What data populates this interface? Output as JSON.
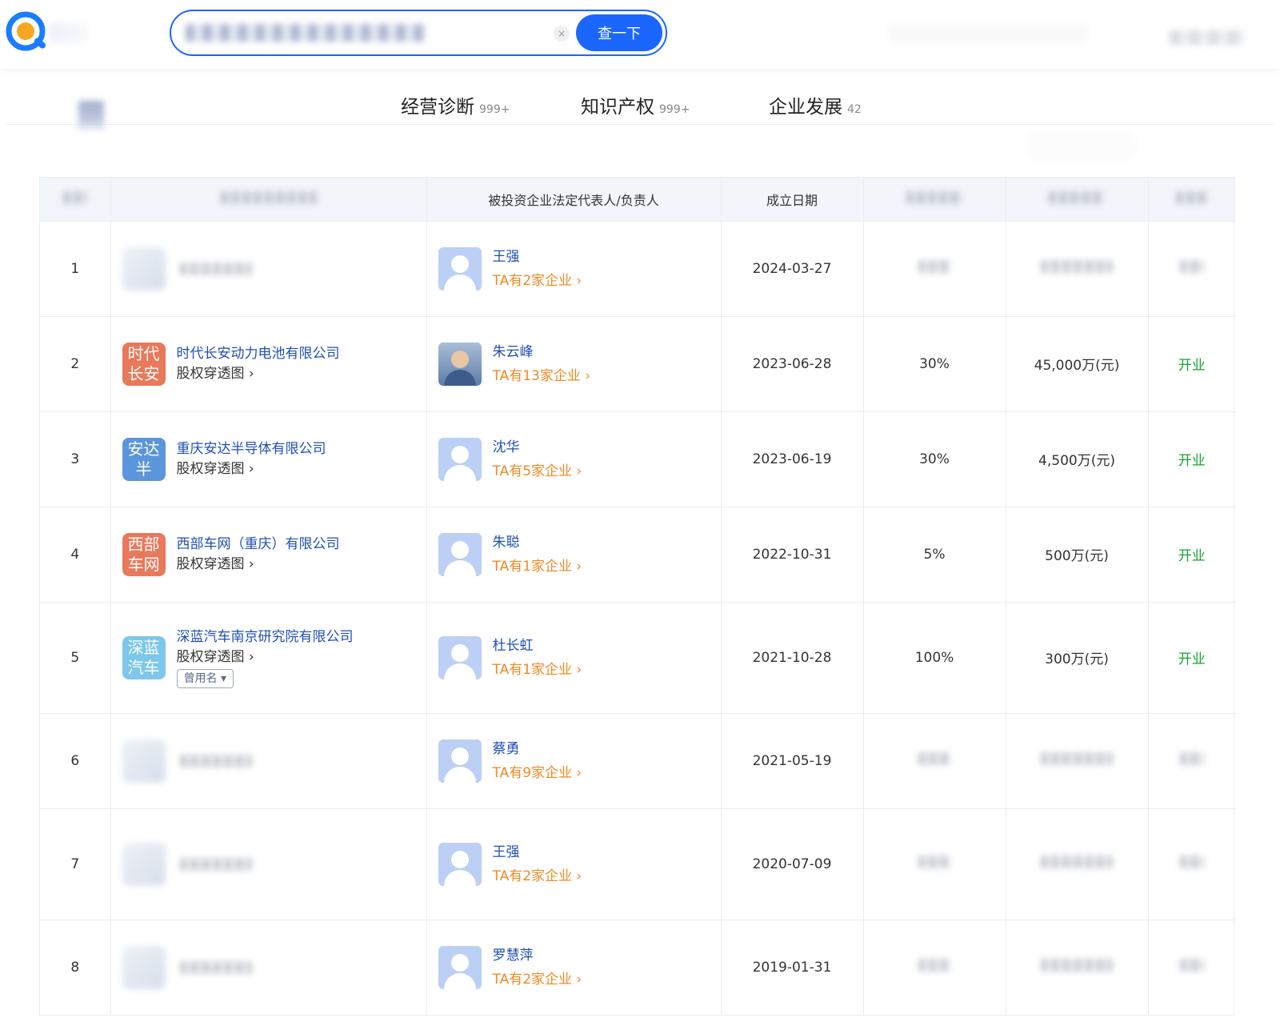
{
  "header": {
    "search_button_label": "查一下",
    "clear_icon": "close-icon",
    "clear_label": "×"
  },
  "tabs": [
    {
      "label": "经营诊断",
      "count": "999+"
    },
    {
      "label": "知识产权",
      "count": "999+"
    },
    {
      "label": "企业发展",
      "count": "42"
    }
  ],
  "table": {
    "columns": [
      "",
      "",
      "被投资企业法定代表人/负责人",
      "成立日期",
      "",
      "",
      ""
    ],
    "rows": [
      {
        "index": "1",
        "company": null,
        "person": "王强",
        "person_count": "TA有2家企业",
        "date": "2024-03-27",
        "ratio": null,
        "capital": null,
        "status": null,
        "avatar": "default"
      },
      {
        "index": "2",
        "company": {
          "logo_text": "时代\n长安",
          "logo_color": "#e8795a",
          "name": "时代长安动力电池有限公司",
          "equity": "股权穿透图"
        },
        "person": "朱云峰",
        "person_count": "TA有13家企业",
        "date": "2023-06-28",
        "ratio": "30%",
        "capital": "45,000万(元)",
        "status": "开业",
        "avatar": "photo"
      },
      {
        "index": "3",
        "company": {
          "logo_text": "安达\n半",
          "logo_color": "#5b95dc",
          "name": "重庆安达半导体有限公司",
          "equity": "股权穿透图"
        },
        "person": "沈华",
        "person_count": "TA有5家企业",
        "date": "2023-06-19",
        "ratio": "30%",
        "capital": "4,500万(元)",
        "status": "开业",
        "avatar": "default"
      },
      {
        "index": "4",
        "company": {
          "logo_text": "西部\n车网",
          "logo_color": "#e8795a",
          "name": "西部车网（重庆）有限公司",
          "equity": "股权穿透图"
        },
        "person": "朱聪",
        "person_count": "TA有1家企业",
        "date": "2022-10-31",
        "ratio": "5%",
        "capital": "500万(元)",
        "status": "开业",
        "avatar": "default"
      },
      {
        "index": "5",
        "company": {
          "logo_text": "深蓝\n汽车",
          "logo_color": "#7cc7ea",
          "name": "深蓝汽车南京研究院有限公司",
          "equity": "股权穿透图",
          "alias": "曾用名"
        },
        "person": "杜长虹",
        "person_count": "TA有1家企业",
        "date": "2021-10-28",
        "ratio": "100%",
        "capital": "300万(元)",
        "status": "开业",
        "avatar": "default"
      },
      {
        "index": "6",
        "company": null,
        "person": "蔡勇",
        "person_count": "TA有9家企业",
        "date": "2021-05-19",
        "ratio": null,
        "capital": null,
        "status": null,
        "avatar": "default"
      },
      {
        "index": "7",
        "company": null,
        "person": "王强",
        "person_count": "TA有2家企业",
        "date": "2020-07-09",
        "ratio": null,
        "capital": null,
        "status": null,
        "avatar": "default"
      },
      {
        "index": "8",
        "company": null,
        "person": "罗慧萍",
        "person_count": "TA有2家企业",
        "date": "2019-01-31",
        "ratio": null,
        "capital": null,
        "status": null,
        "avatar": "default"
      }
    ],
    "row_heights": [
      119,
      119,
      119,
      119,
      139,
      119,
      139,
      119
    ]
  },
  "icons": {
    "chevron": "chevron-right-icon",
    "chevron_glyph": "›",
    "caret": "caret-down-icon",
    "caret_glyph": "▾"
  },
  "colors": {
    "accent": "#1a66ff",
    "link": "#1f4fb4",
    "orange": "#f08a24",
    "status_open": "#1aa332"
  }
}
